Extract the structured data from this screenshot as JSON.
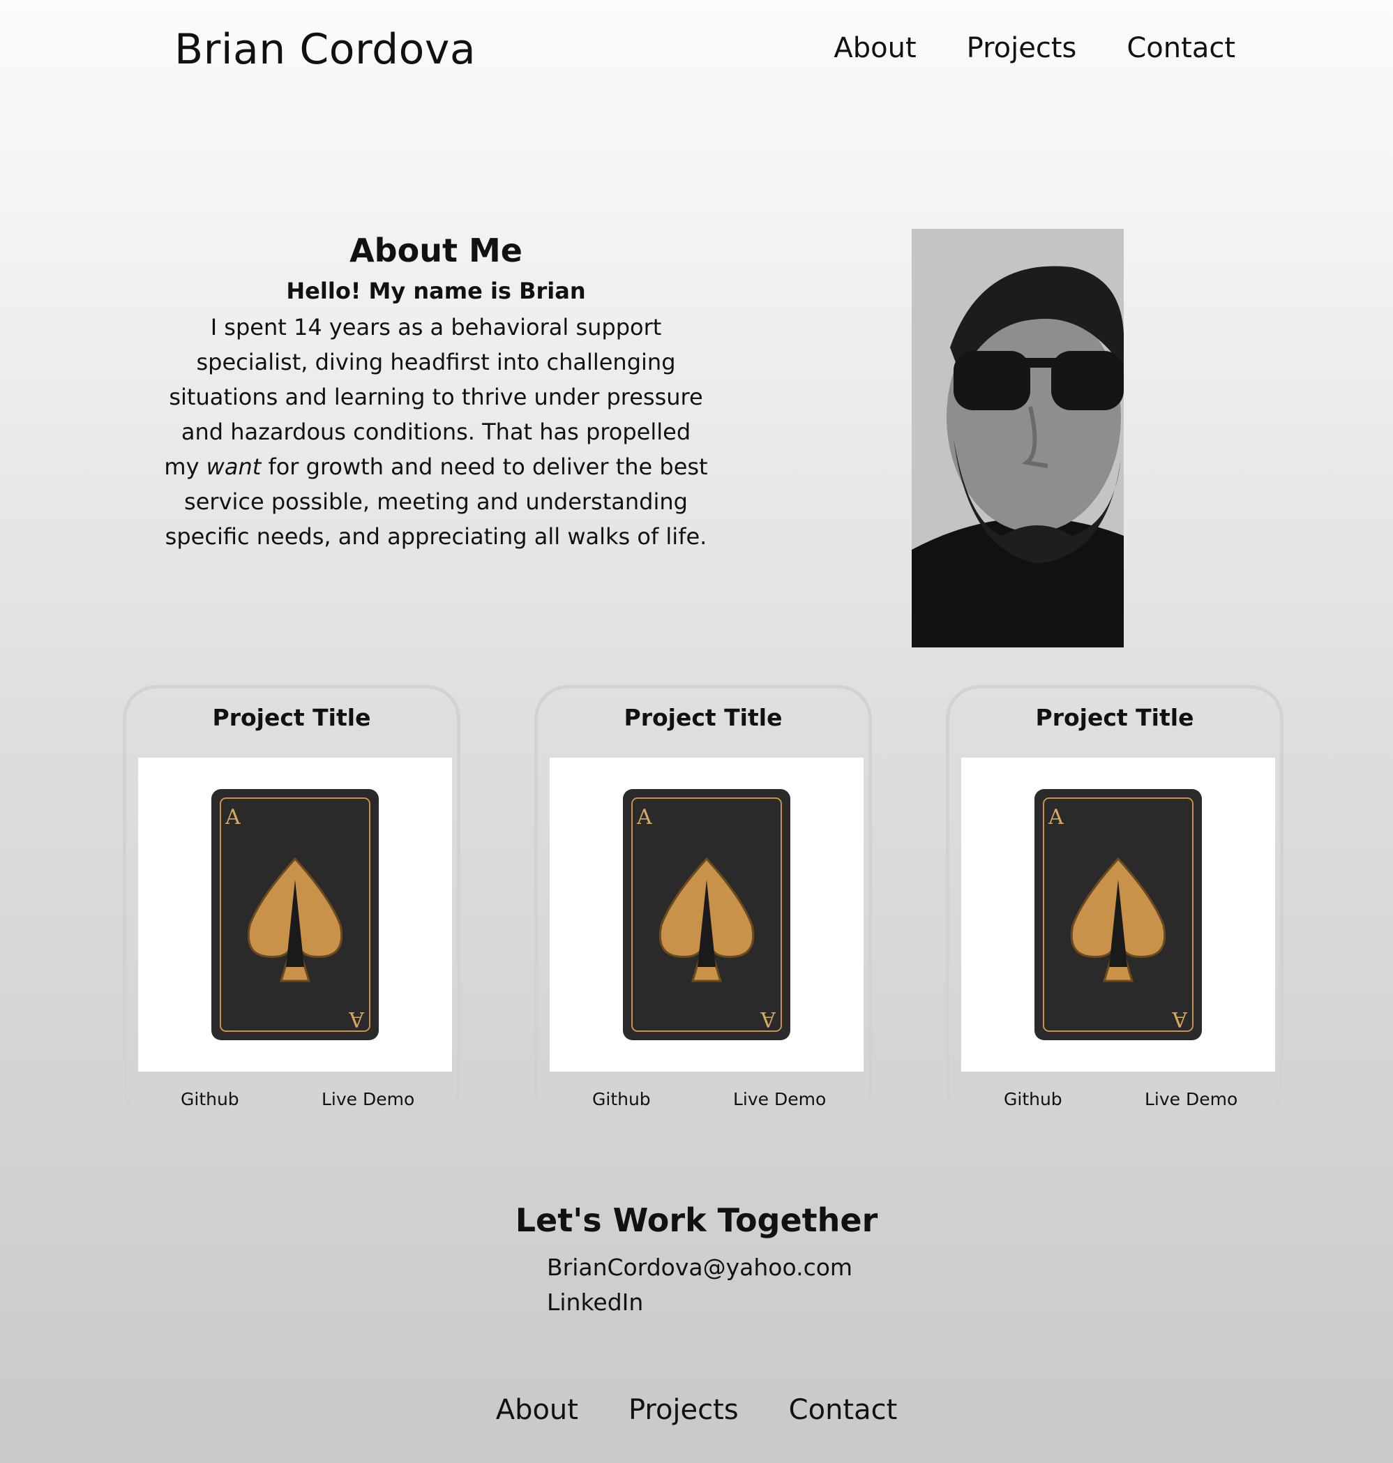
{
  "header": {
    "brand": "Brian Cordova",
    "nav": [
      "About",
      "Projects",
      "Contact"
    ]
  },
  "about": {
    "heading": "About Me",
    "subheading": "Hello! My name is Brian",
    "body_before": "I spent 14 years as a behavioral support specialist, diving headfirst into challenging situations and learning to thrive under pressure and hazardous conditions. That has propelled my ",
    "body_emphasis": "want",
    "body_after": " for growth and need to deliver the best service possible, meeting and understanding specific needs, and appreciating all walks of life.",
    "portrait_icon": "portrait-photo"
  },
  "projects": [
    {
      "title": "Project Title",
      "image_icon": "ace-of-spades-card",
      "github_label": "Github",
      "demo_label": "Live Demo"
    },
    {
      "title": "Project Title",
      "image_icon": "ace-of-spades-card",
      "github_label": "Github",
      "demo_label": "Live Demo"
    },
    {
      "title": "Project Title",
      "image_icon": "ace-of-spades-card",
      "github_label": "Github",
      "demo_label": "Live Demo"
    }
  ],
  "contact": {
    "heading": "Let's Work Together",
    "email": "BrianCordova@yahoo.com",
    "linkedin": "LinkedIn"
  },
  "footer": {
    "nav": [
      "About",
      "Projects",
      "Contact"
    ]
  },
  "colors": {
    "text": "#111111",
    "card_border": "#d2d2d2",
    "card_gold": "#c8924a",
    "card_black": "#2a2a2a"
  }
}
